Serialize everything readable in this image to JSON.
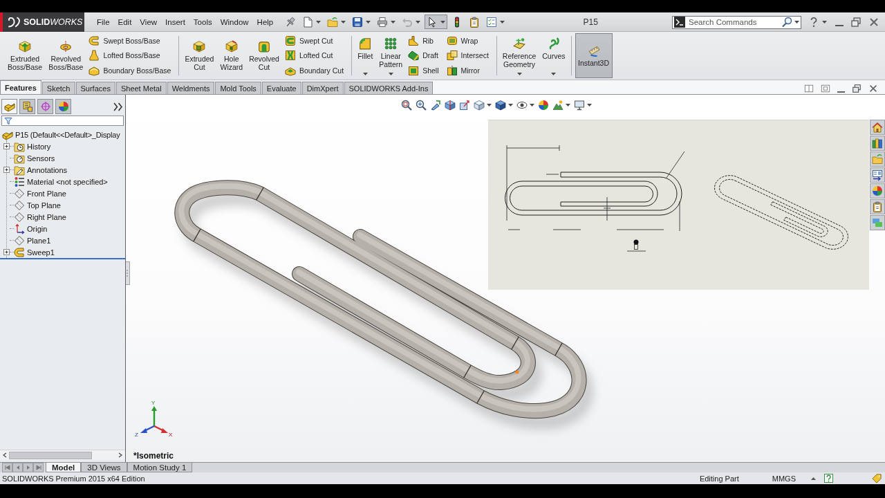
{
  "title_bar": {
    "logo": "**SOLID**WORKS",
    "menu": [
      "File",
      "Edit",
      "View",
      "Insert",
      "Tools",
      "Window",
      "Help"
    ],
    "quick_access": [
      {
        "dropdown": false,
        "disabled": false,
        "pressed": false
      },
      {
        "dropdown": true,
        "disabled": false,
        "pressed": false
      },
      {
        "dropdown": true,
        "disabled": false,
        "pressed": false
      },
      {
        "dropdown": true,
        "disabled": false,
        "pressed": false
      },
      {
        "dropdown": true,
        "disabled": false,
        "pressed": false
      },
      {
        "dropdown": true,
        "disabled": true,
        "pressed": false
      },
      {
        "dropdown": true,
        "disabled": false,
        "pressed": true
      },
      {
        "dropdown": false,
        "disabled": false,
        "pressed": false
      },
      {
        "dropdown": false,
        "disabled": false,
        "pressed": false
      },
      {
        "dropdown": true,
        "disabled": false,
        "pressed": false
      }
    ],
    "document_title": "P15",
    "search": {
      "placeholder": "Search Commands"
    }
  },
  "ribbon": {
    "groups": [
      {
        "items": [
          {
            "kind": "large",
            "label": "Extruded Boss/Base",
            "dropdown": false,
            "pressed": false
          },
          {
            "kind": "large",
            "label": "Revolved Boss/Base",
            "dropdown": false,
            "pressed": false
          },
          {
            "kind": "stack",
            "entries": [
              "Swept Boss/Base",
              "Lofted Boss/Base",
              "Boundary Boss/Base"
            ]
          }
        ]
      },
      {
        "items": [
          {
            "kind": "large",
            "label": "Extruded Cut",
            "dropdown": false,
            "pressed": false
          },
          {
            "kind": "large",
            "label": "Hole Wizard",
            "dropdown": false,
            "pressed": false
          },
          {
            "kind": "large",
            "label": "Revolved Cut",
            "dropdown": false,
            "pressed": false
          },
          {
            "kind": "stack",
            "entries": [
              "Swept Cut",
              "Lofted Cut",
              "Boundary Cut"
            ]
          }
        ]
      },
      {
        "items": [
          {
            "kind": "large",
            "label": "Fillet",
            "dropdown": true,
            "pressed": false
          },
          {
            "kind": "large",
            "label": "Linear Pattern",
            "dropdown": true,
            "pressed": false
          },
          {
            "kind": "stack",
            "entries": [
              "Rib",
              "Draft",
              "Shell"
            ]
          },
          {
            "kind": "stack",
            "entries": [
              "Wrap",
              "Intersect",
              "Mirror"
            ]
          }
        ]
      },
      {
        "items": [
          {
            "kind": "large",
            "label": "Reference Geometry",
            "dropdown": true,
            "pressed": false
          },
          {
            "kind": "large",
            "label": "Curves",
            "dropdown": true,
            "pressed": false
          }
        ]
      },
      {
        "items": [
          {
            "kind": "large",
            "label": "Instant3D",
            "dropdown": false,
            "pressed": true
          }
        ]
      }
    ]
  },
  "command_tabs": [
    {
      "label": "Features",
      "selected": true
    },
    {
      "label": "Sketch",
      "selected": false
    },
    {
      "label": "Surfaces",
      "selected": false
    },
    {
      "label": "Sheet Metal",
      "selected": false
    },
    {
      "label": "Weldments",
      "selected": false
    },
    {
      "label": "Mold Tools",
      "selected": false
    },
    {
      "label": "Evaluate",
      "selected": false
    },
    {
      "label": "DimXpert",
      "selected": false
    },
    {
      "label": "SOLIDWORKS Add-Ins",
      "selected": false
    }
  ],
  "feature_manager": {
    "panel_tabs": [
      {
        "selected": true
      },
      {
        "selected": false
      },
      {
        "selected": false
      },
      {
        "selected": false
      }
    ],
    "tree": {
      "label": "P15 (Default<<Default>_Display",
      "children": [
        {
          "label": "History",
          "expandable": true
        },
        {
          "label": "Sensors",
          "expandable": false
        },
        {
          "label": "Annotations",
          "expandable": true
        },
        {
          "label": "Material <not specified>",
          "expandable": false
        },
        {
          "label": "Front Plane",
          "expandable": false
        },
        {
          "label": "Top Plane",
          "expandable": false
        },
        {
          "label": "Right Plane",
          "expandable": false
        },
        {
          "label": "Origin",
          "expandable": false
        },
        {
          "label": "Plane1",
          "expandable": false
        },
        {
          "label": "Sweep1",
          "expandable": true
        }
      ]
    }
  },
  "viewport": {
    "view_toolbar": [
      {
        "dropdown": false
      },
      {
        "dropdown": false
      },
      {
        "dropdown": false
      },
      {
        "dropdown": false
      },
      {
        "dropdown": false
      },
      {
        "dropdown": true
      },
      {
        "dropdown": true
      },
      {
        "dropdown": true
      },
      {
        "dropdown": false
      },
      {
        "dropdown": true
      },
      {
        "dropdown": true
      }
    ],
    "triad_labels": [
      "Y",
      "X",
      "Z"
    ],
    "view_name": "*Isometric"
  },
  "bottom_tabs": [
    {
      "label": "Model",
      "selected": true
    },
    {
      "label": "3D Views",
      "selected": false
    },
    {
      "label": "Motion Study 1",
      "selected": false
    }
  ],
  "status_bar": {
    "edition": "SOLIDWORKS Premium 2015 x64 Edition",
    "mode": "Editing Part",
    "units": "MMGS"
  }
}
